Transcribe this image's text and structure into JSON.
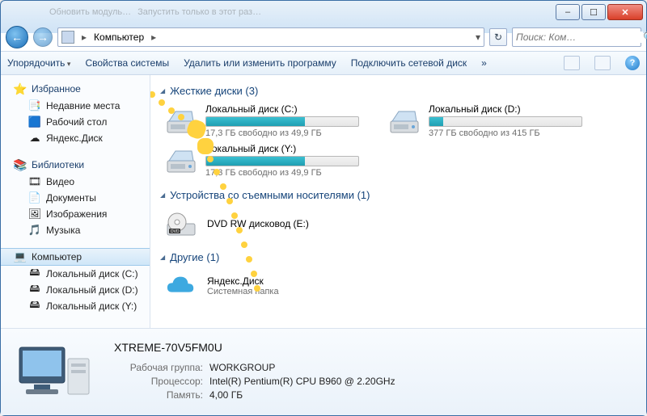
{
  "window": {
    "faded_tabs": [
      "",
      "",
      "Обновить модуль…",
      "Запустить только в этот раз…"
    ],
    "min": "–",
    "max": "☐",
    "close": "✕"
  },
  "nav": {
    "breadcrumb_root": "Компьютер",
    "search_placeholder": "Поиск: Ком…"
  },
  "toolbar": {
    "organize": "Упорядочить",
    "sys_props": "Свойства системы",
    "uninstall": "Удалить или изменить программу",
    "map_drive": "Подключить сетевой диск",
    "overflow": "»"
  },
  "sidebar": {
    "favorites": {
      "title": "Избранное",
      "items": [
        {
          "label": "Недавние места",
          "icon": "📑"
        },
        {
          "label": "Рабочий стол",
          "icon": "🟦"
        },
        {
          "label": "Яндекс.Диск",
          "icon": "☁"
        }
      ]
    },
    "libraries": {
      "title": "Библиотеки",
      "items": [
        {
          "label": "Видео",
          "icon": "🎞"
        },
        {
          "label": "Документы",
          "icon": "📄"
        },
        {
          "label": "Изображения",
          "icon": "🖼"
        },
        {
          "label": "Музыка",
          "icon": "🎵"
        }
      ]
    },
    "computer": {
      "title": "Компьютер",
      "items": [
        {
          "label": "Локальный диск (C:)",
          "icon": "🖴"
        },
        {
          "label": "Локальный диск (D:)",
          "icon": "🖴"
        },
        {
          "label": "Локальный диск (Y:)",
          "icon": "🖴"
        }
      ]
    }
  },
  "content": {
    "cat_hdd": "Жесткие диски (3)",
    "cat_removable": "Устройства со съемными носителями (1)",
    "cat_other": "Другие (1)",
    "drives": [
      {
        "label": "Локальный диск (C:)",
        "free": "17,3 ГБ свободно из 49,9 ГБ",
        "pct": 65
      },
      {
        "label": "Локальный диск (D:)",
        "free": "377 ГБ свободно из 415 ГБ",
        "pct": 9
      },
      {
        "label": "Локальный диск (Y:)",
        "free": "17,3 ГБ свободно из 49,9 ГБ",
        "pct": 65
      }
    ],
    "removable": {
      "label": "DVD RW дисковод (E:)"
    },
    "other": {
      "label": "Яндекс.Диск",
      "sub": "Системная папка"
    }
  },
  "details": {
    "name": "XTREME-70V5FM0U",
    "workgroup_k": "Рабочая группа:",
    "workgroup_v": "WORKGROUP",
    "cpu_k": "Процессор:",
    "cpu_v": "Intel(R) Pentium(R) CPU B960 @ 2.20GHz",
    "ram_k": "Память:",
    "ram_v": "4,00 ГБ"
  }
}
